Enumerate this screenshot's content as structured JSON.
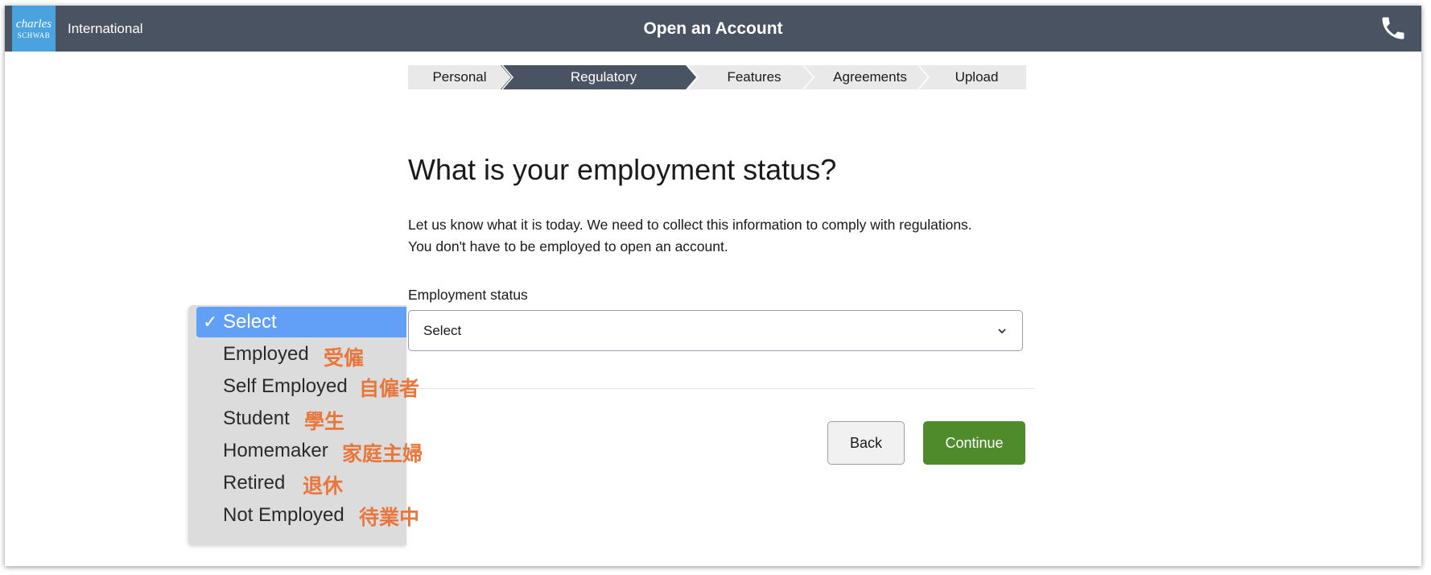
{
  "header": {
    "logo_line1": "charles",
    "logo_line2": "SCHWAB",
    "region": "International",
    "title": "Open an Account",
    "phone_icon": "phone-icon"
  },
  "steps": [
    {
      "label": "Personal",
      "active": false
    },
    {
      "label": "Regulatory",
      "active": true
    },
    {
      "label": "Features",
      "active": false
    },
    {
      "label": "Agreements",
      "active": false
    },
    {
      "label": "Upload",
      "active": false
    }
  ],
  "main": {
    "heading": "What is your employment status?",
    "description_line1": "Let us know what it is today. We need to collect this information to comply with regulations.",
    "description_line2": "You don't have to be employed to open an account.",
    "field_label": "Employment status",
    "select_value": "Select"
  },
  "dropdown": {
    "check_mark": "✓",
    "options": [
      {
        "label": "Select",
        "selected": true
      },
      {
        "label": "Employed",
        "selected": false
      },
      {
        "label": "Self Employed",
        "selected": false
      },
      {
        "label": "Student",
        "selected": false
      },
      {
        "label": "Homemaker",
        "selected": false
      },
      {
        "label": "Retired",
        "selected": false
      },
      {
        "label": "Not Employed",
        "selected": false
      }
    ]
  },
  "annotations": [
    "受僱",
    "自僱者",
    "學生",
    "家庭主婦",
    "退休",
    "待業中"
  ],
  "buttons": {
    "back": "Back",
    "continue": "Continue"
  },
  "colors": {
    "header_bg": "#4a5361",
    "logo_bg": "#4aa3df",
    "active_step": "#4a5361",
    "inactive_step": "#e9e9e9",
    "continue_button": "#4f8a2b",
    "dropdown_highlight": "#62a0f8",
    "annotation_text": "#e8773d"
  }
}
